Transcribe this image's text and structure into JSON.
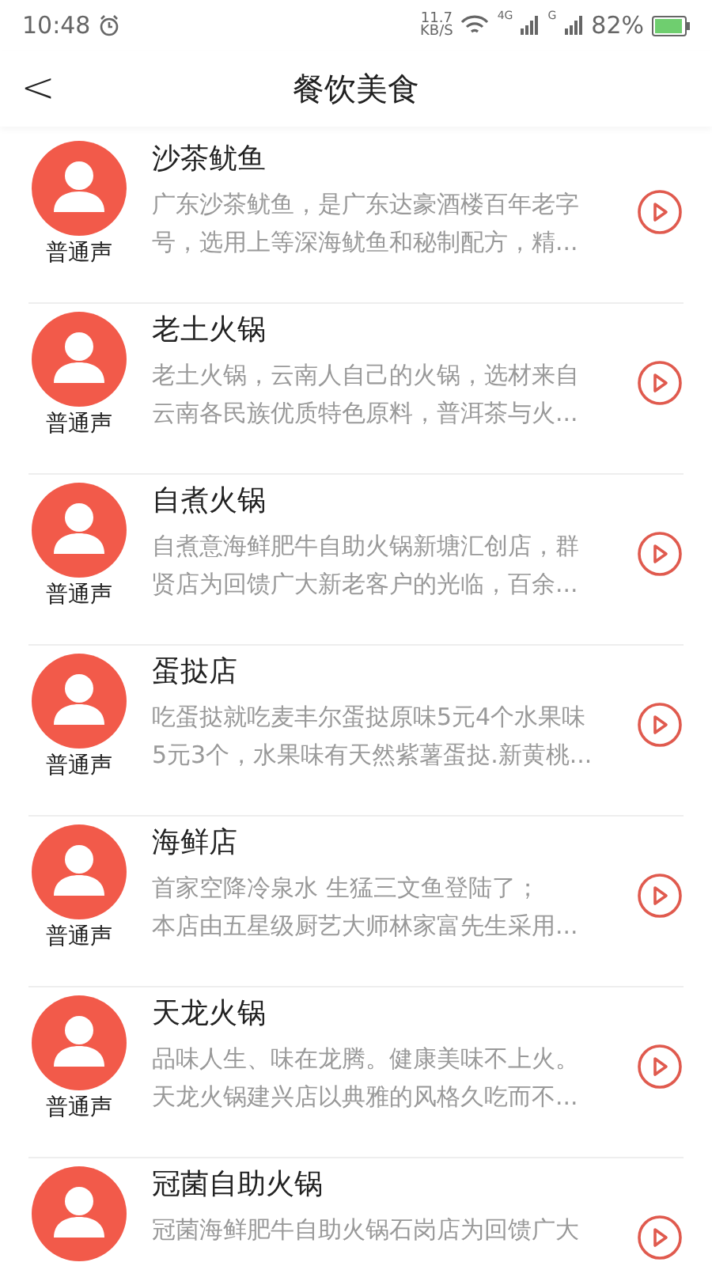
{
  "status_bar": {
    "time": "10:48",
    "speed_value": "11.7",
    "speed_unit": "KB/S",
    "sim1_type": "4G",
    "sim2_type": "G",
    "battery": "82%"
  },
  "header": {
    "back": "<",
    "title": "餐饮美食"
  },
  "items": [
    {
      "title": "沙茶鱿鱼",
      "voice": "普通声",
      "lines": [
        "广东沙茶鱿鱼，是广东达豪酒楼百年老字",
        "号，选用上等深海鱿鱼和秘制配方，精..."
      ]
    },
    {
      "title": "老土火锅",
      "voice": "普通声",
      "lines": [
        "老土火锅，云南人自己的火锅，选材来自",
        "云南各民族优质特色原料，普洱茶与火..."
      ]
    },
    {
      "title": "自煮火锅",
      "voice": "普通声",
      "lines": [
        "自煮意海鲜肥牛自助火锅新塘汇创店，群",
        "贤店为回馈广大新老客户的光临，百余..."
      ]
    },
    {
      "title": "蛋挞店",
      "voice": "普通声",
      "lines": [
        "吃蛋挞就吃麦丰尔蛋挞原味5元4个水果味",
        "5元3个，水果味有天然紫薯蛋挞.新黄桃..."
      ]
    },
    {
      "title": "海鲜店",
      "voice": "普通声",
      "lines": [
        "首家空降冷泉水 生猛三文鱼登陆了；",
        "本店由五星级厨艺大师林家富先生采用..."
      ]
    },
    {
      "title": "天龙火锅",
      "voice": "普通声",
      "lines": [
        "品味人生、味在龙腾。健康美味不上火。",
        "天龙火锅建兴店以典雅的风格久吃而不..."
      ]
    },
    {
      "title": "冠菌自助火锅",
      "lines": [
        "冠菌海鲜肥牛自助火锅石岗店为回馈广大"
      ]
    }
  ]
}
